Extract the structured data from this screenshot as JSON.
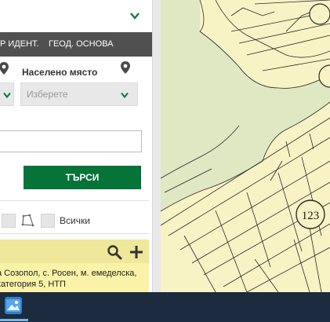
{
  "tabs": [
    "Р ИДЕНТ.",
    "ГЕОД. ОСНОВА"
  ],
  "location": {
    "label": "Населено място",
    "placeholder": "Изберете"
  },
  "search": {
    "button_label": "ТЪРСИ"
  },
  "filters": {
    "all_label": "Всички"
  },
  "result": {
    "text": "а Созопол, с. Росен, м. емеделска, категория 5, НТП"
  },
  "map": {
    "parcel_number": "123",
    "background_color": "#f7f3c5"
  },
  "colors": {
    "accent_green": "#067338",
    "tab_bar": "#505050",
    "result_bg": "#faf3a7",
    "taskbar": "#1c2b3d"
  }
}
